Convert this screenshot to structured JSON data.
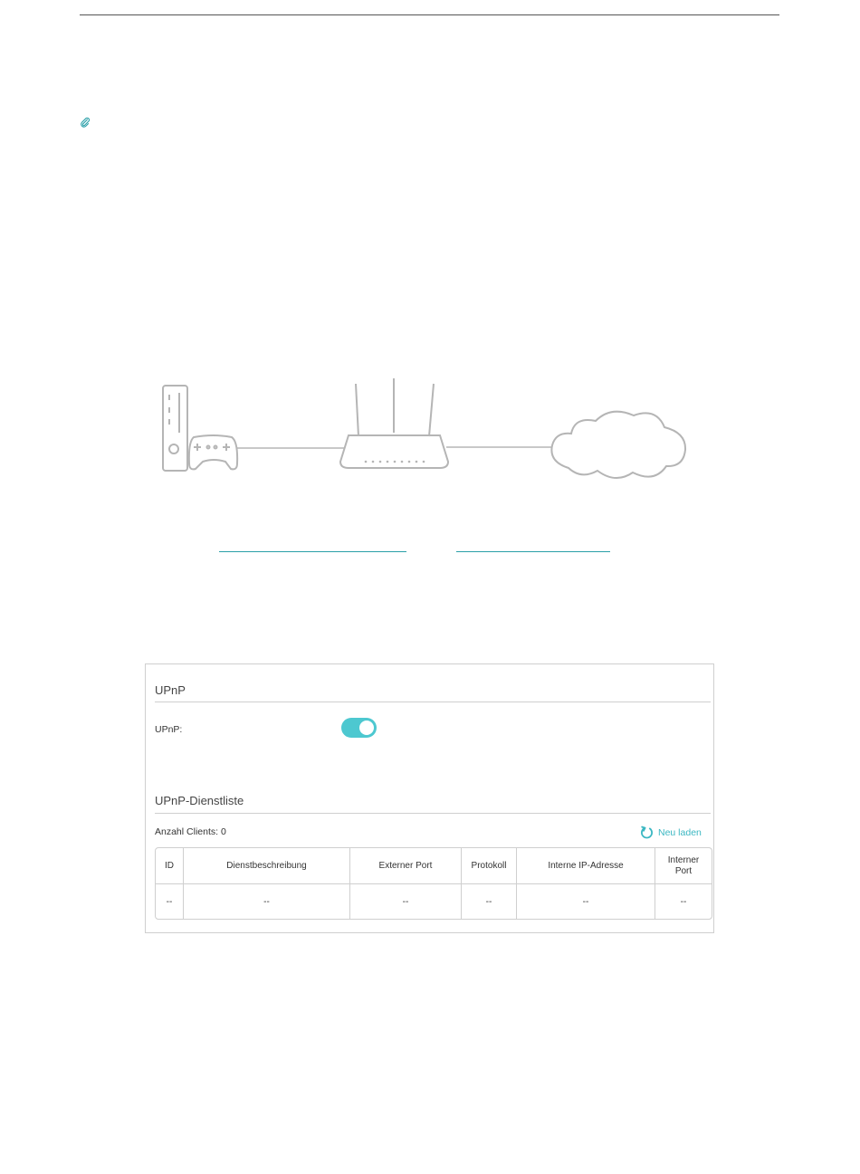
{
  "upnp_section": {
    "title": "UPnP",
    "toggle_label": "UPnP:",
    "enabled": true,
    "accent_color": "#4dc8d0"
  },
  "service_list": {
    "title": "UPnP-Dienstliste",
    "client_count_label": "Anzahl Clients: 0",
    "reload_label": "Neu laden",
    "columns": [
      "ID",
      "Dienstbeschreibung",
      "Externer Port",
      "Protokoll",
      "Interne IP-Adresse",
      "Interner Port"
    ],
    "rows": [
      [
        "--",
        "--",
        "--",
        "--",
        "--",
        "--"
      ]
    ]
  },
  "icons": {
    "note": "paperclip-icon",
    "reload": "refresh-icon",
    "diagram": [
      "game-console-icon",
      "gamepad-icon",
      "router-icon",
      "cloud-icon"
    ]
  }
}
